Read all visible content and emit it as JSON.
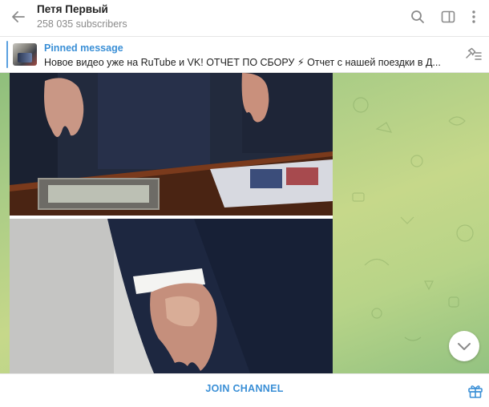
{
  "header": {
    "title": "Петя Первый",
    "subtitle": "258 035 subscribers",
    "icons": [
      "back-arrow-icon",
      "search-icon",
      "sidebar-toggle-icon",
      "more-vertical-icon"
    ]
  },
  "pinned": {
    "label": "Pinned message",
    "text": "Новое видео уже на RuTube и VK!   ОТЧЕТ ПО СБОРУ ⚡  Отчет с нашей поездки в Д...",
    "icons": [
      "pin-list-icon"
    ]
  },
  "chat": {
    "photos": [
      "photo-hand-desk",
      "photo-hand-close"
    ]
  },
  "bottom": {
    "join_label": "JOIN CHANNEL",
    "icons": [
      "gift-icon"
    ]
  },
  "colors": {
    "accent": "#3a8fd6",
    "wallpaper_green": "#a9cc86"
  }
}
